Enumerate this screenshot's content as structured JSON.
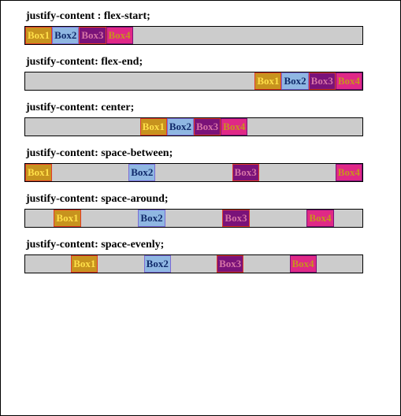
{
  "boxes": {
    "b1": "Box1",
    "b2": "Box2",
    "b3": "Box3",
    "b4": "Box4"
  },
  "sections": [
    {
      "label": "justify-content : flex-start;",
      "class": "jc-flex-start"
    },
    {
      "label": "justify-content: flex-end;",
      "class": "jc-flex-end"
    },
    {
      "label": "justify-content: center;",
      "class": "jc-center"
    },
    {
      "label": "justify-content: space-between;",
      "class": "jc-space-between"
    },
    {
      "label": "justify-content: space-around;",
      "class": "jc-space-around"
    },
    {
      "label": "justify-content: space-evenly;",
      "class": "jc-space-evenly"
    }
  ]
}
